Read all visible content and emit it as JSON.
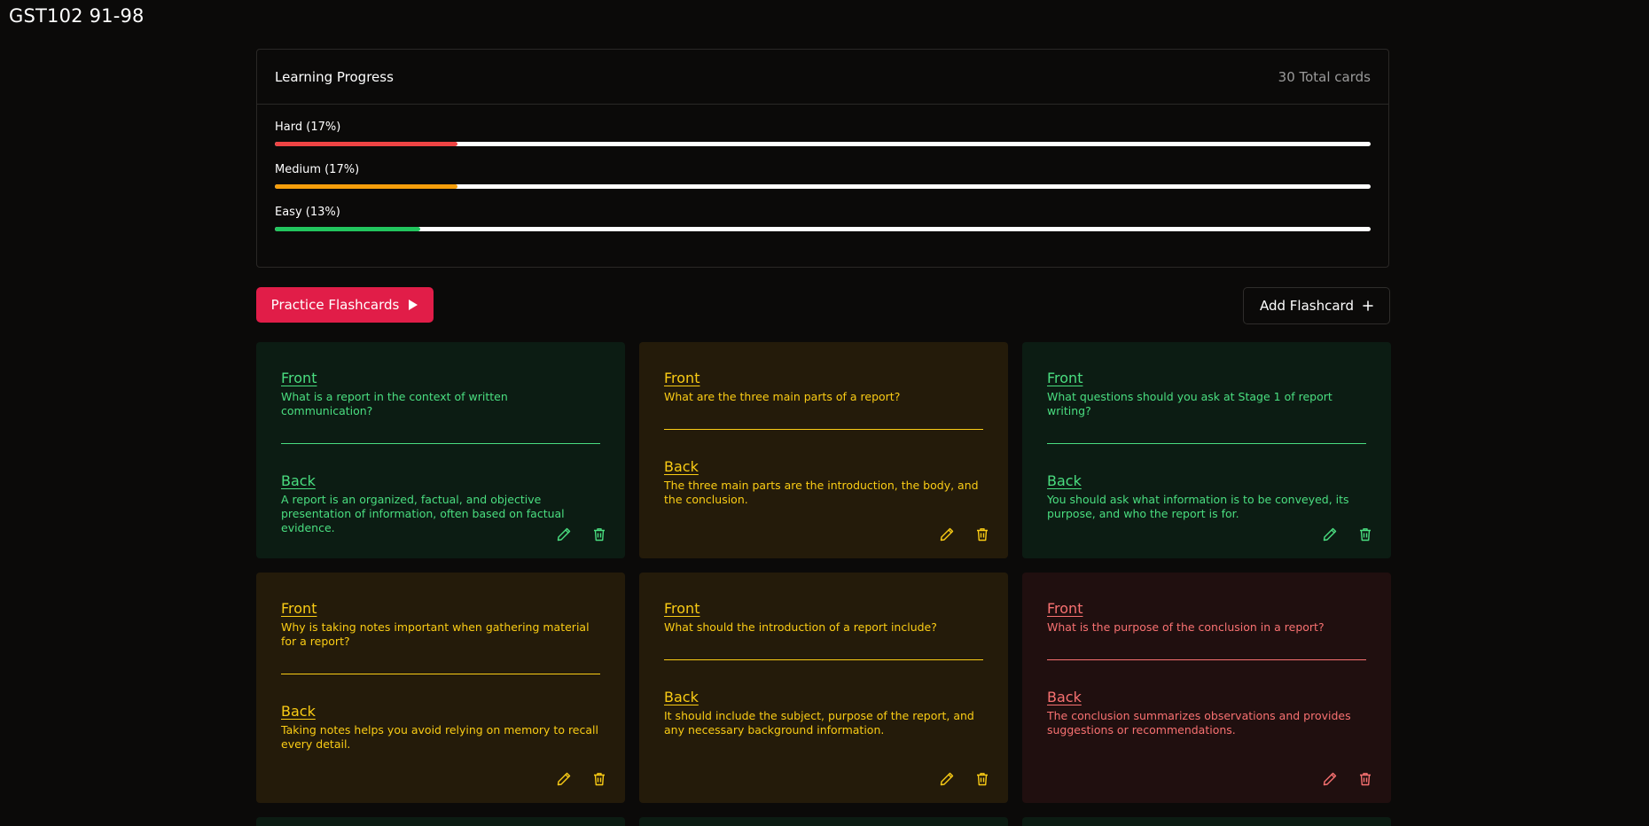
{
  "page": {
    "title": "GST102 91-98"
  },
  "progress": {
    "title": "Learning Progress",
    "total_label": "30 Total cards",
    "bars": [
      {
        "label": "Hard (17%)",
        "percent": 16.7,
        "color": "#ef4444"
      },
      {
        "label": "Medium (17%)",
        "percent": 16.7,
        "color": "#f59e0b"
      },
      {
        "label": "Easy (13%)",
        "percent": 13.3,
        "color": "#22c55e"
      }
    ]
  },
  "actions": {
    "practice_label": "Practice Flashcards",
    "add_label": "Add Flashcard"
  },
  "cards": [
    {
      "theme": "green",
      "front_label": "Front",
      "front": "What is a report in the context of written communication?",
      "back_label": "Back",
      "back": "A report is an organized, factual, and objective presentation of information, often based on factual evidence."
    },
    {
      "theme": "amber",
      "front_label": "Front",
      "front": "What are the three main parts of a report?",
      "back_label": "Back",
      "back": "The three main parts are the introduction, the body, and the conclusion."
    },
    {
      "theme": "green",
      "front_label": "Front",
      "front": "What questions should you ask at Stage 1 of report writing?",
      "back_label": "Back",
      "back": "You should ask what information is to be conveyed, its purpose, and who the report is for."
    },
    {
      "theme": "amber",
      "front_label": "Front",
      "front": "Why is taking notes important when gathering material for a report?",
      "back_label": "Back",
      "back": "Taking notes helps you avoid relying on memory to recall every detail."
    },
    {
      "theme": "amber",
      "front_label": "Front",
      "front": "What should the introduction of a report include?",
      "back_label": "Back",
      "back": "It should include the subject, purpose of the report, and any necessary background information."
    },
    {
      "theme": "red",
      "front_label": "Front",
      "front": "What is the purpose of the conclusion in a report?",
      "back_label": "Back",
      "back": "The conclusion summarizes observations and provides suggestions or recommendations."
    }
  ]
}
